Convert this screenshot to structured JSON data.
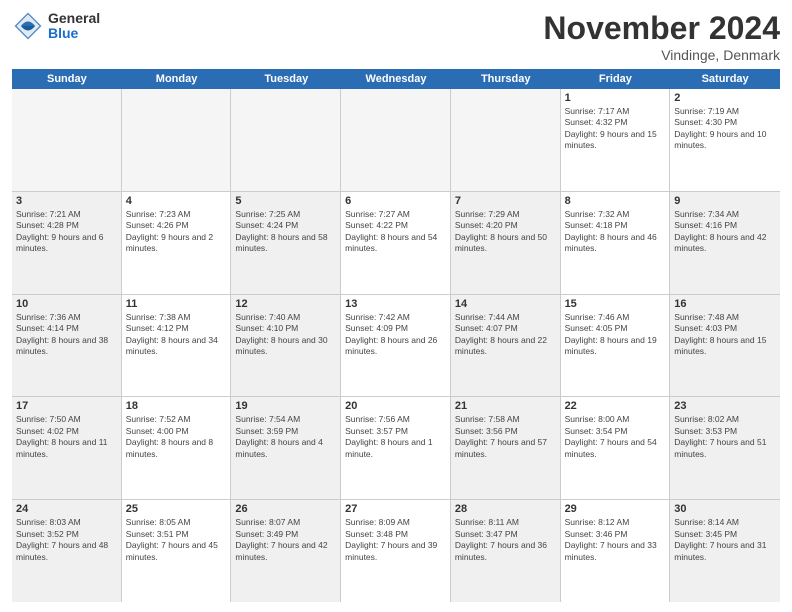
{
  "logo": {
    "general": "General",
    "blue": "Blue"
  },
  "title": "November 2024",
  "location": "Vindinge, Denmark",
  "days_of_week": [
    "Sunday",
    "Monday",
    "Tuesday",
    "Wednesday",
    "Thursday",
    "Friday",
    "Saturday"
  ],
  "rows": [
    [
      {
        "day": "",
        "info": "",
        "empty": true
      },
      {
        "day": "",
        "info": "",
        "empty": true
      },
      {
        "day": "",
        "info": "",
        "empty": true
      },
      {
        "day": "",
        "info": "",
        "empty": true
      },
      {
        "day": "",
        "info": "",
        "empty": true
      },
      {
        "day": "1",
        "info": "Sunrise: 7:17 AM\nSunset: 4:32 PM\nDaylight: 9 hours and 15 minutes."
      },
      {
        "day": "2",
        "info": "Sunrise: 7:19 AM\nSunset: 4:30 PM\nDaylight: 9 hours and 10 minutes."
      }
    ],
    [
      {
        "day": "3",
        "info": "Sunrise: 7:21 AM\nSunset: 4:28 PM\nDaylight: 9 hours and 6 minutes.",
        "shaded": true
      },
      {
        "day": "4",
        "info": "Sunrise: 7:23 AM\nSunset: 4:26 PM\nDaylight: 9 hours and 2 minutes."
      },
      {
        "day": "5",
        "info": "Sunrise: 7:25 AM\nSunset: 4:24 PM\nDaylight: 8 hours and 58 minutes.",
        "shaded": true
      },
      {
        "day": "6",
        "info": "Sunrise: 7:27 AM\nSunset: 4:22 PM\nDaylight: 8 hours and 54 minutes."
      },
      {
        "day": "7",
        "info": "Sunrise: 7:29 AM\nSunset: 4:20 PM\nDaylight: 8 hours and 50 minutes.",
        "shaded": true
      },
      {
        "day": "8",
        "info": "Sunrise: 7:32 AM\nSunset: 4:18 PM\nDaylight: 8 hours and 46 minutes."
      },
      {
        "day": "9",
        "info": "Sunrise: 7:34 AM\nSunset: 4:16 PM\nDaylight: 8 hours and 42 minutes.",
        "shaded": true
      }
    ],
    [
      {
        "day": "10",
        "info": "Sunrise: 7:36 AM\nSunset: 4:14 PM\nDaylight: 8 hours and 38 minutes.",
        "shaded": true
      },
      {
        "day": "11",
        "info": "Sunrise: 7:38 AM\nSunset: 4:12 PM\nDaylight: 8 hours and 34 minutes."
      },
      {
        "day": "12",
        "info": "Sunrise: 7:40 AM\nSunset: 4:10 PM\nDaylight: 8 hours and 30 minutes.",
        "shaded": true
      },
      {
        "day": "13",
        "info": "Sunrise: 7:42 AM\nSunset: 4:09 PM\nDaylight: 8 hours and 26 minutes."
      },
      {
        "day": "14",
        "info": "Sunrise: 7:44 AM\nSunset: 4:07 PM\nDaylight: 8 hours and 22 minutes.",
        "shaded": true
      },
      {
        "day": "15",
        "info": "Sunrise: 7:46 AM\nSunset: 4:05 PM\nDaylight: 8 hours and 19 minutes."
      },
      {
        "day": "16",
        "info": "Sunrise: 7:48 AM\nSunset: 4:03 PM\nDaylight: 8 hours and 15 minutes.",
        "shaded": true
      }
    ],
    [
      {
        "day": "17",
        "info": "Sunrise: 7:50 AM\nSunset: 4:02 PM\nDaylight: 8 hours and 11 minutes.",
        "shaded": true
      },
      {
        "day": "18",
        "info": "Sunrise: 7:52 AM\nSunset: 4:00 PM\nDaylight: 8 hours and 8 minutes."
      },
      {
        "day": "19",
        "info": "Sunrise: 7:54 AM\nSunset: 3:59 PM\nDaylight: 8 hours and 4 minutes.",
        "shaded": true
      },
      {
        "day": "20",
        "info": "Sunrise: 7:56 AM\nSunset: 3:57 PM\nDaylight: 8 hours and 1 minute."
      },
      {
        "day": "21",
        "info": "Sunrise: 7:58 AM\nSunset: 3:56 PM\nDaylight: 7 hours and 57 minutes.",
        "shaded": true
      },
      {
        "day": "22",
        "info": "Sunrise: 8:00 AM\nSunset: 3:54 PM\nDaylight: 7 hours and 54 minutes."
      },
      {
        "day": "23",
        "info": "Sunrise: 8:02 AM\nSunset: 3:53 PM\nDaylight: 7 hours and 51 minutes.",
        "shaded": true
      }
    ],
    [
      {
        "day": "24",
        "info": "Sunrise: 8:03 AM\nSunset: 3:52 PM\nDaylight: 7 hours and 48 minutes.",
        "shaded": true
      },
      {
        "day": "25",
        "info": "Sunrise: 8:05 AM\nSunset: 3:51 PM\nDaylight: 7 hours and 45 minutes."
      },
      {
        "day": "26",
        "info": "Sunrise: 8:07 AM\nSunset: 3:49 PM\nDaylight: 7 hours and 42 minutes.",
        "shaded": true
      },
      {
        "day": "27",
        "info": "Sunrise: 8:09 AM\nSunset: 3:48 PM\nDaylight: 7 hours and 39 minutes."
      },
      {
        "day": "28",
        "info": "Sunrise: 8:11 AM\nSunset: 3:47 PM\nDaylight: 7 hours and 36 minutes.",
        "shaded": true
      },
      {
        "day": "29",
        "info": "Sunrise: 8:12 AM\nSunset: 3:46 PM\nDaylight: 7 hours and 33 minutes."
      },
      {
        "day": "30",
        "info": "Sunrise: 8:14 AM\nSunset: 3:45 PM\nDaylight: 7 hours and 31 minutes.",
        "shaded": true
      }
    ]
  ]
}
